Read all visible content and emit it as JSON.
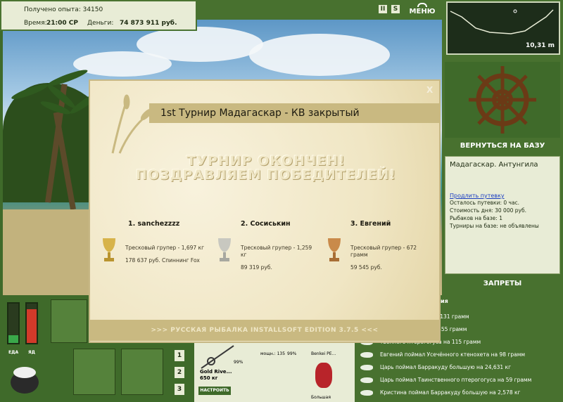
{
  "infobar": {
    "experience": "Получено опыта: 34150",
    "time_label": "Время:",
    "time_value": "21:00 СР",
    "money_label": "Деньги:",
    "money_value": "74 873 911 руб."
  },
  "toolbar": {
    "pause_label": "II",
    "s_label": "S",
    "menu_label": "МЕНЮ"
  },
  "minimap": {
    "depth": "10,31 m"
  },
  "right_panel": {
    "return_button": "ВЕРНУТЬСЯ НА БАЗУ",
    "base_name": "Мадагаскар. Антунгила",
    "extend_link": "Продлить путевку",
    "voucher_left": "Осталось путевки: 0 час.",
    "day_cost": "Стоимость дня: 30 000 руб.",
    "fishers": "Рыбаков на базе: 1",
    "tournaments": "Турниры на базе: не объявлены",
    "bans_button": "ЗАПРЕТЫ"
  },
  "news": {
    "header": "ия",
    "items": [
      "ённого ктенохета на 131 грамм",
      "шеротого губана на 455 грамм",
      "твенного птерогогуса на 115 грамм",
      "Евгений поймал Усечённого ктенохета на 98 грамм",
      "Царь поймал Барракуду большую на 24,631 кг",
      "Царь поймал Таинственного птерогогуса на 59 грамм",
      "Кристина поймал Барракуду большую на 2,578 кг"
    ]
  },
  "status_bars": {
    "food_label": "ЕДА",
    "food_level": 0.2,
    "poison_label": "ЯД",
    "poison_level": 0.85,
    "food_color": "#3aa84a",
    "poison_color": "#d23a2a"
  },
  "slots": [
    "1",
    "2",
    "3"
  ],
  "gear": {
    "percent_a": "99%",
    "percent_b": "99%",
    "power_label": "мощн.: 135",
    "reel_name": "Gold Rive...",
    "reel_weight": "650 кг",
    "build_button": "НАСТРОИТЬ",
    "lure_name": "Benkei PE...",
    "lure_sub": "Большая"
  },
  "dialog": {
    "title": "1st Турнир Мадагаскар - КВ закрытый",
    "close": "X",
    "headline1": "ТУРНИР ОКОНЧЕН!",
    "headline2": "ПОЗДРАВЛЯЕМ ПОБЕДИТЕЛЕЙ!",
    "winners": [
      {
        "name": "1. sanchezzzz",
        "fish": "Тресковый групер - 1,697 кг",
        "prize": "178 637 руб. Спиннинг Fox"
      },
      {
        "name": "2. Сосиськин",
        "fish": "Тресковый групер - 1,259 кг",
        "prize": "89 319 руб."
      },
      {
        "name": "3. Евгений",
        "fish": "Тресковый групер - 672 грамм",
        "prize": "59 545 руб."
      }
    ],
    "footer": ">>> РУССКАЯ РЫБАЛКА INSTALLSOFT EDITION 3.7.5 <<<"
  },
  "colors": {
    "panel_green": "#48712f",
    "panel_light": "#e8ecd6",
    "dialog_gold": "#c9b981",
    "gold_cup": "#d7b34a",
    "silver_cup": "#c8c8c0",
    "bronze_cup": "#c98a4a"
  }
}
